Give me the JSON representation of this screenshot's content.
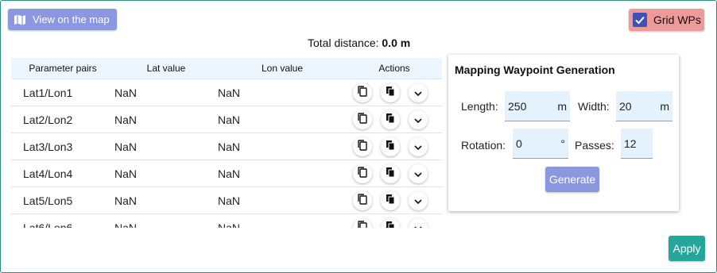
{
  "header": {
    "map_button_label": "View on the map",
    "grid_button_label": "Grid WPs",
    "grid_checked": true,
    "total_label": "Total distance:",
    "total_value": "0.0 m"
  },
  "table": {
    "columns": [
      "Parameter pairs",
      "Lat value",
      "Lon value",
      "Actions"
    ],
    "rows": [
      {
        "pair": "Lat1/Lon1",
        "lat": "NaN",
        "lon": "NaN"
      },
      {
        "pair": "Lat2/Lon2",
        "lat": "NaN",
        "lon": "NaN"
      },
      {
        "pair": "Lat3/Lon3",
        "lat": "NaN",
        "lon": "NaN"
      },
      {
        "pair": "Lat4/Lon4",
        "lat": "NaN",
        "lon": "NaN"
      },
      {
        "pair": "Lat5/Lon5",
        "lat": "NaN",
        "lon": "NaN"
      },
      {
        "pair": "Lat6/Lon6",
        "lat": "NaN",
        "lon": "NaN"
      }
    ]
  },
  "panel": {
    "title": "Mapping Waypoint Generation",
    "length_label": "Length:",
    "length_value": "250",
    "length_unit": "m",
    "width_label": "Width:",
    "width_value": "20",
    "width_unit": "m",
    "rotation_label": "Rotation:",
    "rotation_value": "0",
    "rotation_unit": "°",
    "passes_label": "Passes:",
    "passes_value": "12",
    "generate_label": "Generate"
  },
  "footer": {
    "apply_label": "Apply"
  },
  "colors": {
    "primary": "#8b97e0",
    "grid_button": "#ef9a9a",
    "apply": "#26a69a",
    "field_bg": "#e3f2fd"
  }
}
